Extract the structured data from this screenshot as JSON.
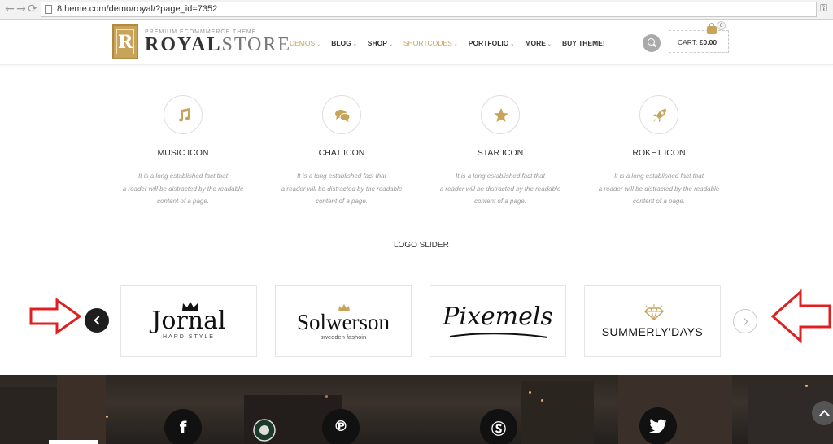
{
  "browser": {
    "url": "8theme.com/demo/royal/?page_id=7352",
    "back_icon": "arrow-left",
    "forward_icon": "arrow-right",
    "reload_icon": "reload"
  },
  "header": {
    "logo_letter": "R",
    "tagline": "PREMIUM ECOMMMERCE THEME",
    "brand_bold": "ROYAL",
    "brand_light": "STORE",
    "menu": [
      {
        "label": "DEMOS",
        "caret": true,
        "highlight": true
      },
      {
        "label": "BLOG",
        "caret": true,
        "highlight": false
      },
      {
        "label": "SHOP",
        "caret": true,
        "highlight": false
      },
      {
        "label": "SHORTCODES",
        "caret": true,
        "highlight": true
      },
      {
        "label": "PORTFOLIO",
        "caret": true,
        "highlight": false
      },
      {
        "label": "MORE",
        "caret": true,
        "highlight": false
      },
      {
        "label": "BUY THEME!",
        "caret": false,
        "highlight": false
      }
    ],
    "cart_label": "CART:",
    "cart_total": "£0.00",
    "cart_count": "0"
  },
  "features": [
    {
      "title": "MUSIC ICON",
      "icon": "music-icon",
      "text_lines": [
        "It is a long established fact that",
        "a reader will be distracted by the readable",
        "content of a page."
      ]
    },
    {
      "title": "CHAT ICON",
      "icon": "chat-icon",
      "text_lines": [
        "It is a long established fact that",
        "a reader will be distracted by the readable",
        "content of a page."
      ]
    },
    {
      "title": "STAR ICON",
      "icon": "star-icon",
      "text_lines": [
        "It is a long established fact that",
        "a reader will be distracted by the readable",
        "content of a page."
      ]
    },
    {
      "title": "ROKET ICON",
      "icon": "rocket-icon",
      "text_lines": [
        "It is a long established fact that",
        "a reader will be distracted by the readable",
        "content of a page."
      ]
    }
  ],
  "slider": {
    "title": "LOGO SLIDER",
    "logos": [
      {
        "name": "Jornal",
        "sub": "HARD STYLE"
      },
      {
        "name": "Solwerson",
        "sub": "sweeden fashoin"
      },
      {
        "name": "Pixemels",
        "sub": ""
      },
      {
        "name": "SUMMERLY'DAYS",
        "sub": ""
      }
    ]
  },
  "colors": {
    "accent": "#c8a35a",
    "annotation": "#e02020"
  },
  "footer": {
    "social": [
      "facebook-icon",
      "starbucks-logo",
      "pinterest-icon",
      "skype-icon",
      "twitter-icon"
    ]
  }
}
